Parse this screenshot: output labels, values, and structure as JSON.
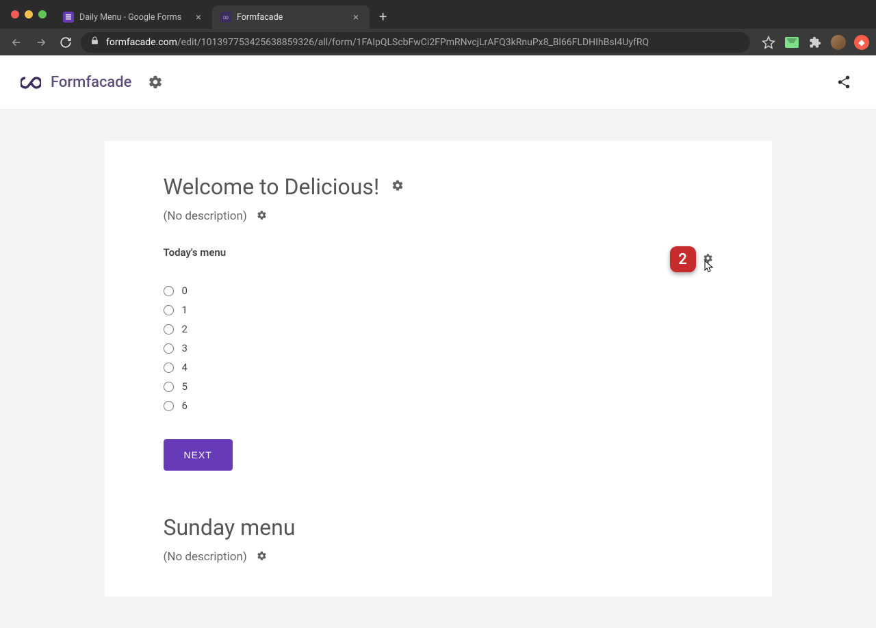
{
  "browser": {
    "tabs": [
      {
        "title": "Daily Menu - Google Forms",
        "active": false
      },
      {
        "title": "Formfacade",
        "active": true
      }
    ],
    "url_host": "formfacade.com",
    "url_path": "/edit/101397753425638859326/all/form/1FAIpQLScbFwCi2FPmRNvcjLrAFQ3kRnuPx8_Bl66FLDHIhBsI4UyfRQ"
  },
  "header": {
    "brand": "Formfacade"
  },
  "form": {
    "title": "Welcome to Delicious!",
    "desc": "(No description)",
    "question1": {
      "label": "Today's menu",
      "badge": "2",
      "options": [
        "0",
        "1",
        "2",
        "3",
        "4",
        "5",
        "6"
      ]
    },
    "next_label": "NEXT",
    "section2_title": "Sunday menu",
    "section2_desc": "(No description)"
  }
}
